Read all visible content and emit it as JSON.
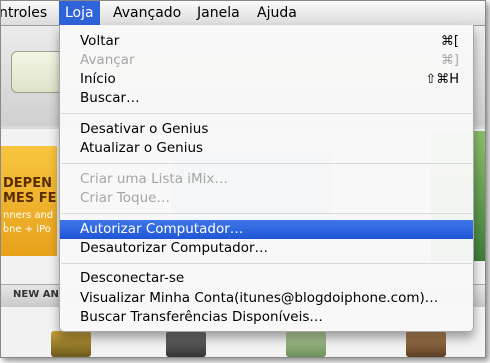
{
  "menubar": {
    "items": [
      "ntroles",
      "Loja",
      "Avançado",
      "Janela",
      "Ajuda"
    ]
  },
  "background": {
    "banner_line1": "DEPEN",
    "banner_line2": "MES FE",
    "banner_line3": "nners and l",
    "banner_line4": "one + iPo",
    "section_label": "NEW AN"
  },
  "menu": {
    "voltar": {
      "label": "Voltar",
      "shortcut": "⌘["
    },
    "avancar": {
      "label": "Avançar",
      "shortcut": "⌘]"
    },
    "inicio": {
      "label": "Início",
      "shortcut": "⇧⌘H"
    },
    "buscar": {
      "label": "Buscar…"
    },
    "desativar_genius": {
      "label": "Desativar o Genius"
    },
    "atualizar_genius": {
      "label": "Atualizar o Genius"
    },
    "criar_imix": {
      "label": "Criar uma Lista iMix…"
    },
    "criar_toque": {
      "label": "Criar Toque…"
    },
    "autorizar": {
      "label": "Autorizar Computador…"
    },
    "desautorizar": {
      "label": "Desautorizar Computador…"
    },
    "desconectar": {
      "label": "Desconectar-se"
    },
    "visualizar_conta": {
      "label": "Visualizar Minha Conta(itunes@blogdoiphone.com)…"
    },
    "buscar_transferencias": {
      "label": "Buscar Transferências Disponíveis…"
    }
  }
}
